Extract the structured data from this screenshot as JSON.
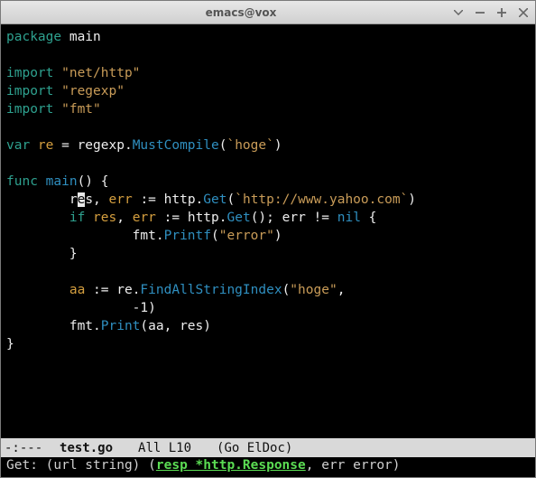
{
  "window": {
    "title": "emacs@vox"
  },
  "code": {
    "l1_kw": "package ",
    "l1_pkg": "main",
    "l3_kw": "import ",
    "l3_str": "\"net/http\"",
    "l4_kw": "import ",
    "l4_str": "\"regexp\"",
    "l5_kw": "import ",
    "l5_str": "\"fmt\"",
    "l7_kw": "var ",
    "l7_var": "re",
    "l7_mid": " = regexp.",
    "l7_fn": "MustCompile",
    "l7_paren": "(",
    "l7_str": "`hoge`",
    "l7_end": ")",
    "l9_kw": "func ",
    "l9_fn": "main",
    "l9_end": "() {",
    "l10_indent": "        r",
    "l10_cur": "e",
    "l10_a": "s, ",
    "l10_var": "err",
    "l10_b": " := http.",
    "l10_fn": "Get",
    "l10_c": "(",
    "l10_str": "`http://www.yahoo.com`",
    "l10_d": ")",
    "l11_a": "        ",
    "l11_kw": "if ",
    "l11_v1": "res",
    "l11_b": ", ",
    "l11_v2": "err",
    "l11_c": " := http.",
    "l11_fn": "Get",
    "l11_d": "(); err != ",
    "l11_ty": "nil",
    "l11_e": " {",
    "l12_a": "                fmt.",
    "l12_fn": "Printf",
    "l12_b": "(",
    "l12_str": "\"error\"",
    "l12_c": ")",
    "l13": "        }",
    "l15_a": "        ",
    "l15_var": "aa",
    "l15_b": " := re.",
    "l15_fn": "FindAllStringIndex",
    "l15_c": "(",
    "l15_str": "\"hoge\"",
    "l15_d": ",",
    "l16": "                -1)",
    "l17_a": "        fmt.",
    "l17_fn": "Print",
    "l17_b": "(aa, res)",
    "l18": "}"
  },
  "modeline": {
    "left": "-:---",
    "buffer": "test.go",
    "pos": "All L10",
    "mode": "(Go ElDoc)"
  },
  "echo": {
    "pre": "Get: (url string) (",
    "hl": "resp *http.Response",
    "post": ", err error)"
  }
}
